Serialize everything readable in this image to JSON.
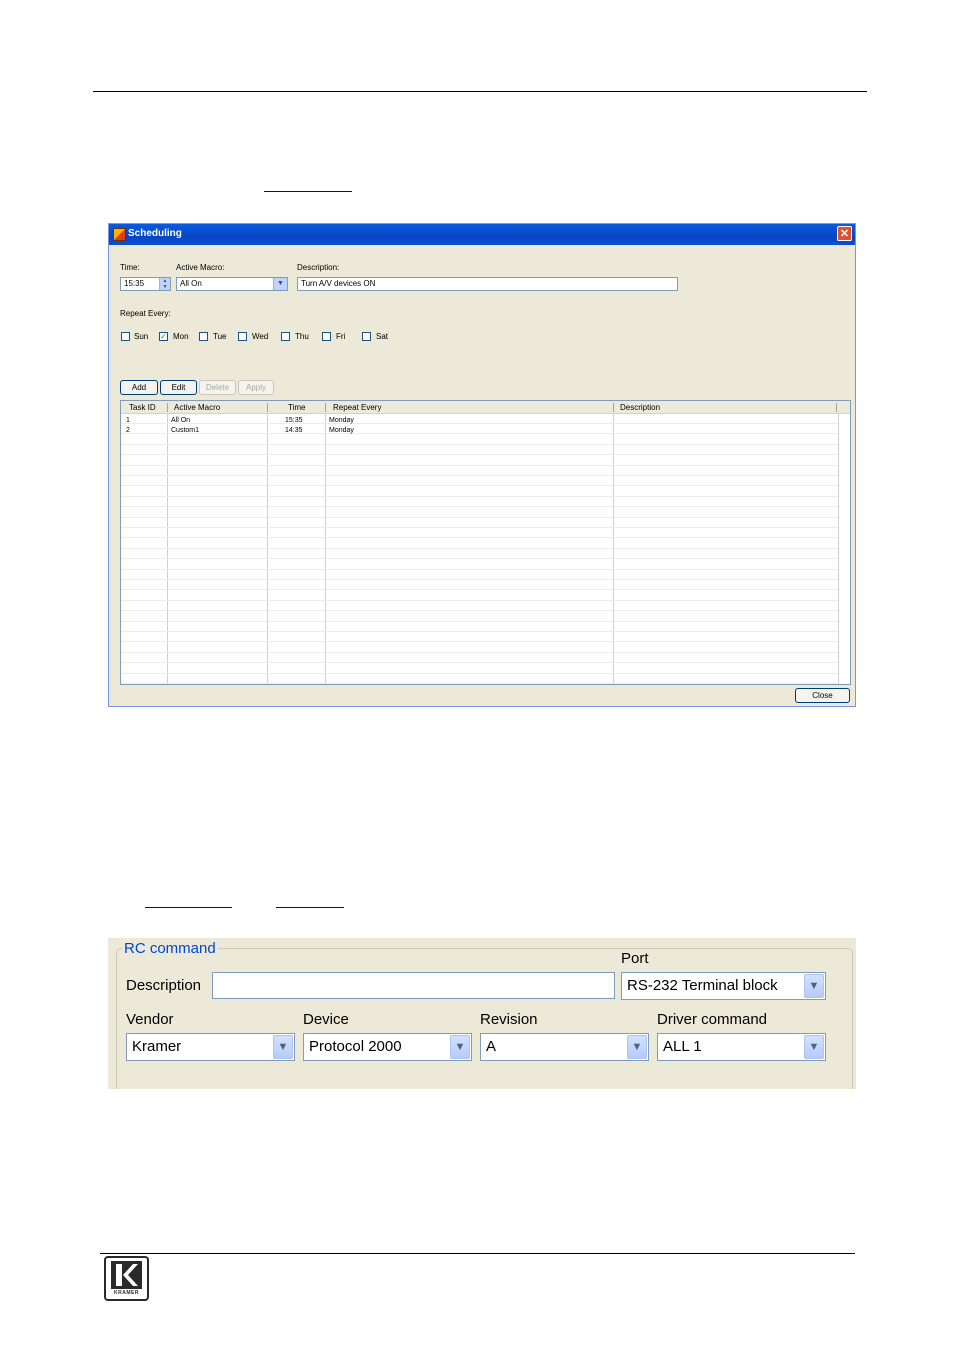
{
  "scheduling": {
    "title": "Scheduling",
    "time_label": "Time:",
    "time_value": "15:35",
    "macro_label": "Active Macro:",
    "macro_value": "All On",
    "desc_label": "Description:",
    "desc_value": "Turn A/V devices ON",
    "repeat_label": "Repeat Every:",
    "days": [
      {
        "label": "Sun",
        "checked": false
      },
      {
        "label": "Mon",
        "checked": true
      },
      {
        "label": "Tue",
        "checked": false
      },
      {
        "label": "Wed",
        "checked": false
      },
      {
        "label": "Thu",
        "checked": false
      },
      {
        "label": "Fri",
        "checked": false
      },
      {
        "label": "Sat",
        "checked": false
      }
    ],
    "buttons": {
      "add": "Add",
      "edit": "Edit",
      "delete": "Delete",
      "apply": "Apply",
      "close": "Close"
    },
    "columns": [
      "Task ID",
      "Active Macro",
      "Time",
      "Repeat Every",
      "Description"
    ],
    "rows": [
      {
        "id": "1",
        "macro": "All On",
        "time": "15:35",
        "repeat": "Monday",
        "desc": ""
      },
      {
        "id": "2",
        "macro": "Custom1",
        "time": "14:35",
        "repeat": "Monday",
        "desc": ""
      }
    ]
  },
  "rc_command": {
    "legend": "RC command",
    "description_label": "Description",
    "description_value": "",
    "port_label": "Port",
    "port_value": "RS-232 Terminal block",
    "vendor_label": "Vendor",
    "vendor_value": "Kramer",
    "device_label": "Device",
    "device_value": "Protocol 2000",
    "revision_label": "Revision",
    "revision_value": "A",
    "driver_label": "Driver command",
    "driver_value": "ALL 1"
  },
  "footer": {
    "logo_text": "KRAMER"
  }
}
